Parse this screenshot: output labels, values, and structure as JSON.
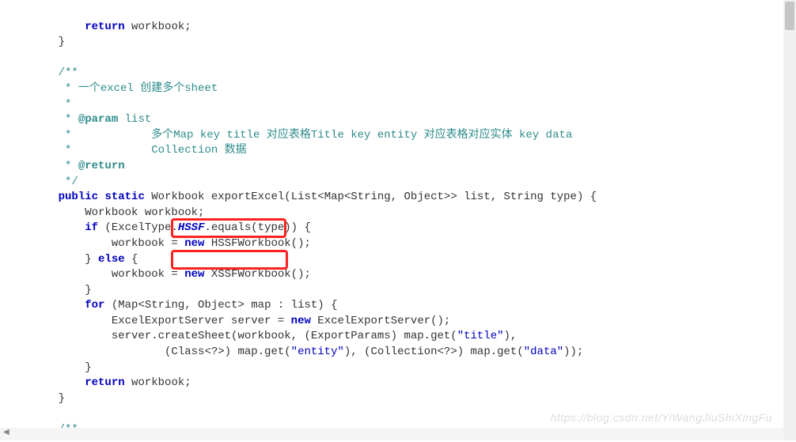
{
  "code": {
    "l1_ret": "return",
    "l1_var": " workbook;",
    "l2": "}",
    "c1": "/**",
    "c2": " * 一个excel 创建多个sheet",
    "c3": " *",
    "c4_star": " * ",
    "c4_tag": "@param",
    "c4_rest": " list",
    "c5": " *            多个Map key title 对应表格Title key entity 对应表格对应实体 key data",
    "c6": " *            Collection 数据",
    "c7_star": " * ",
    "c7_tag": "@return",
    "c8": " */",
    "sig_public": "public",
    "sig_static": "static",
    "sig_rest1": " Workbook exportExcel(List<Map<String, Object>> list, String type) {",
    "l3": "    Workbook workbook;",
    "l4_if": "if",
    "l4_rest1": " (ExcelType.",
    "l4_hssf": "HSSF",
    "l4_rest2": ".equals(type)) {",
    "l5_wb": "        workbook = ",
    "l5_new": "new",
    "l5_ctor": " HSSFWorkbook();",
    "l6_close": "    } ",
    "l6_else": "else",
    "l6_open": " {",
    "l7_wb": "        workbook = ",
    "l7_new": "new",
    "l7_ctor": " XSSFWorkbook();",
    "l8": "    }",
    "l9_for": "for",
    "l9_rest": " (Map<String, Object> map : list) {",
    "l10_a": "        ExcelExportServer server = ",
    "l10_new": "new",
    "l10_b": " ExcelExportServer();",
    "l11_a": "        server.createSheet(workbook, (ExportParams) map.get(",
    "l11_s1": "\"title\"",
    "l11_b": "),",
    "l12_a": "                (Class<?>) map.get(",
    "l12_s1": "\"entity\"",
    "l12_b": "), (Collection<?>) map.get(",
    "l12_s2": "\"data\"",
    "l12_c": "));",
    "l13": "    }",
    "l14_ret": "return",
    "l14_var": " workbook;",
    "l15": "}",
    "c9": "/**"
  },
  "watermark": "https://blog.csdn.net/YiWangJiuShiXingFu"
}
